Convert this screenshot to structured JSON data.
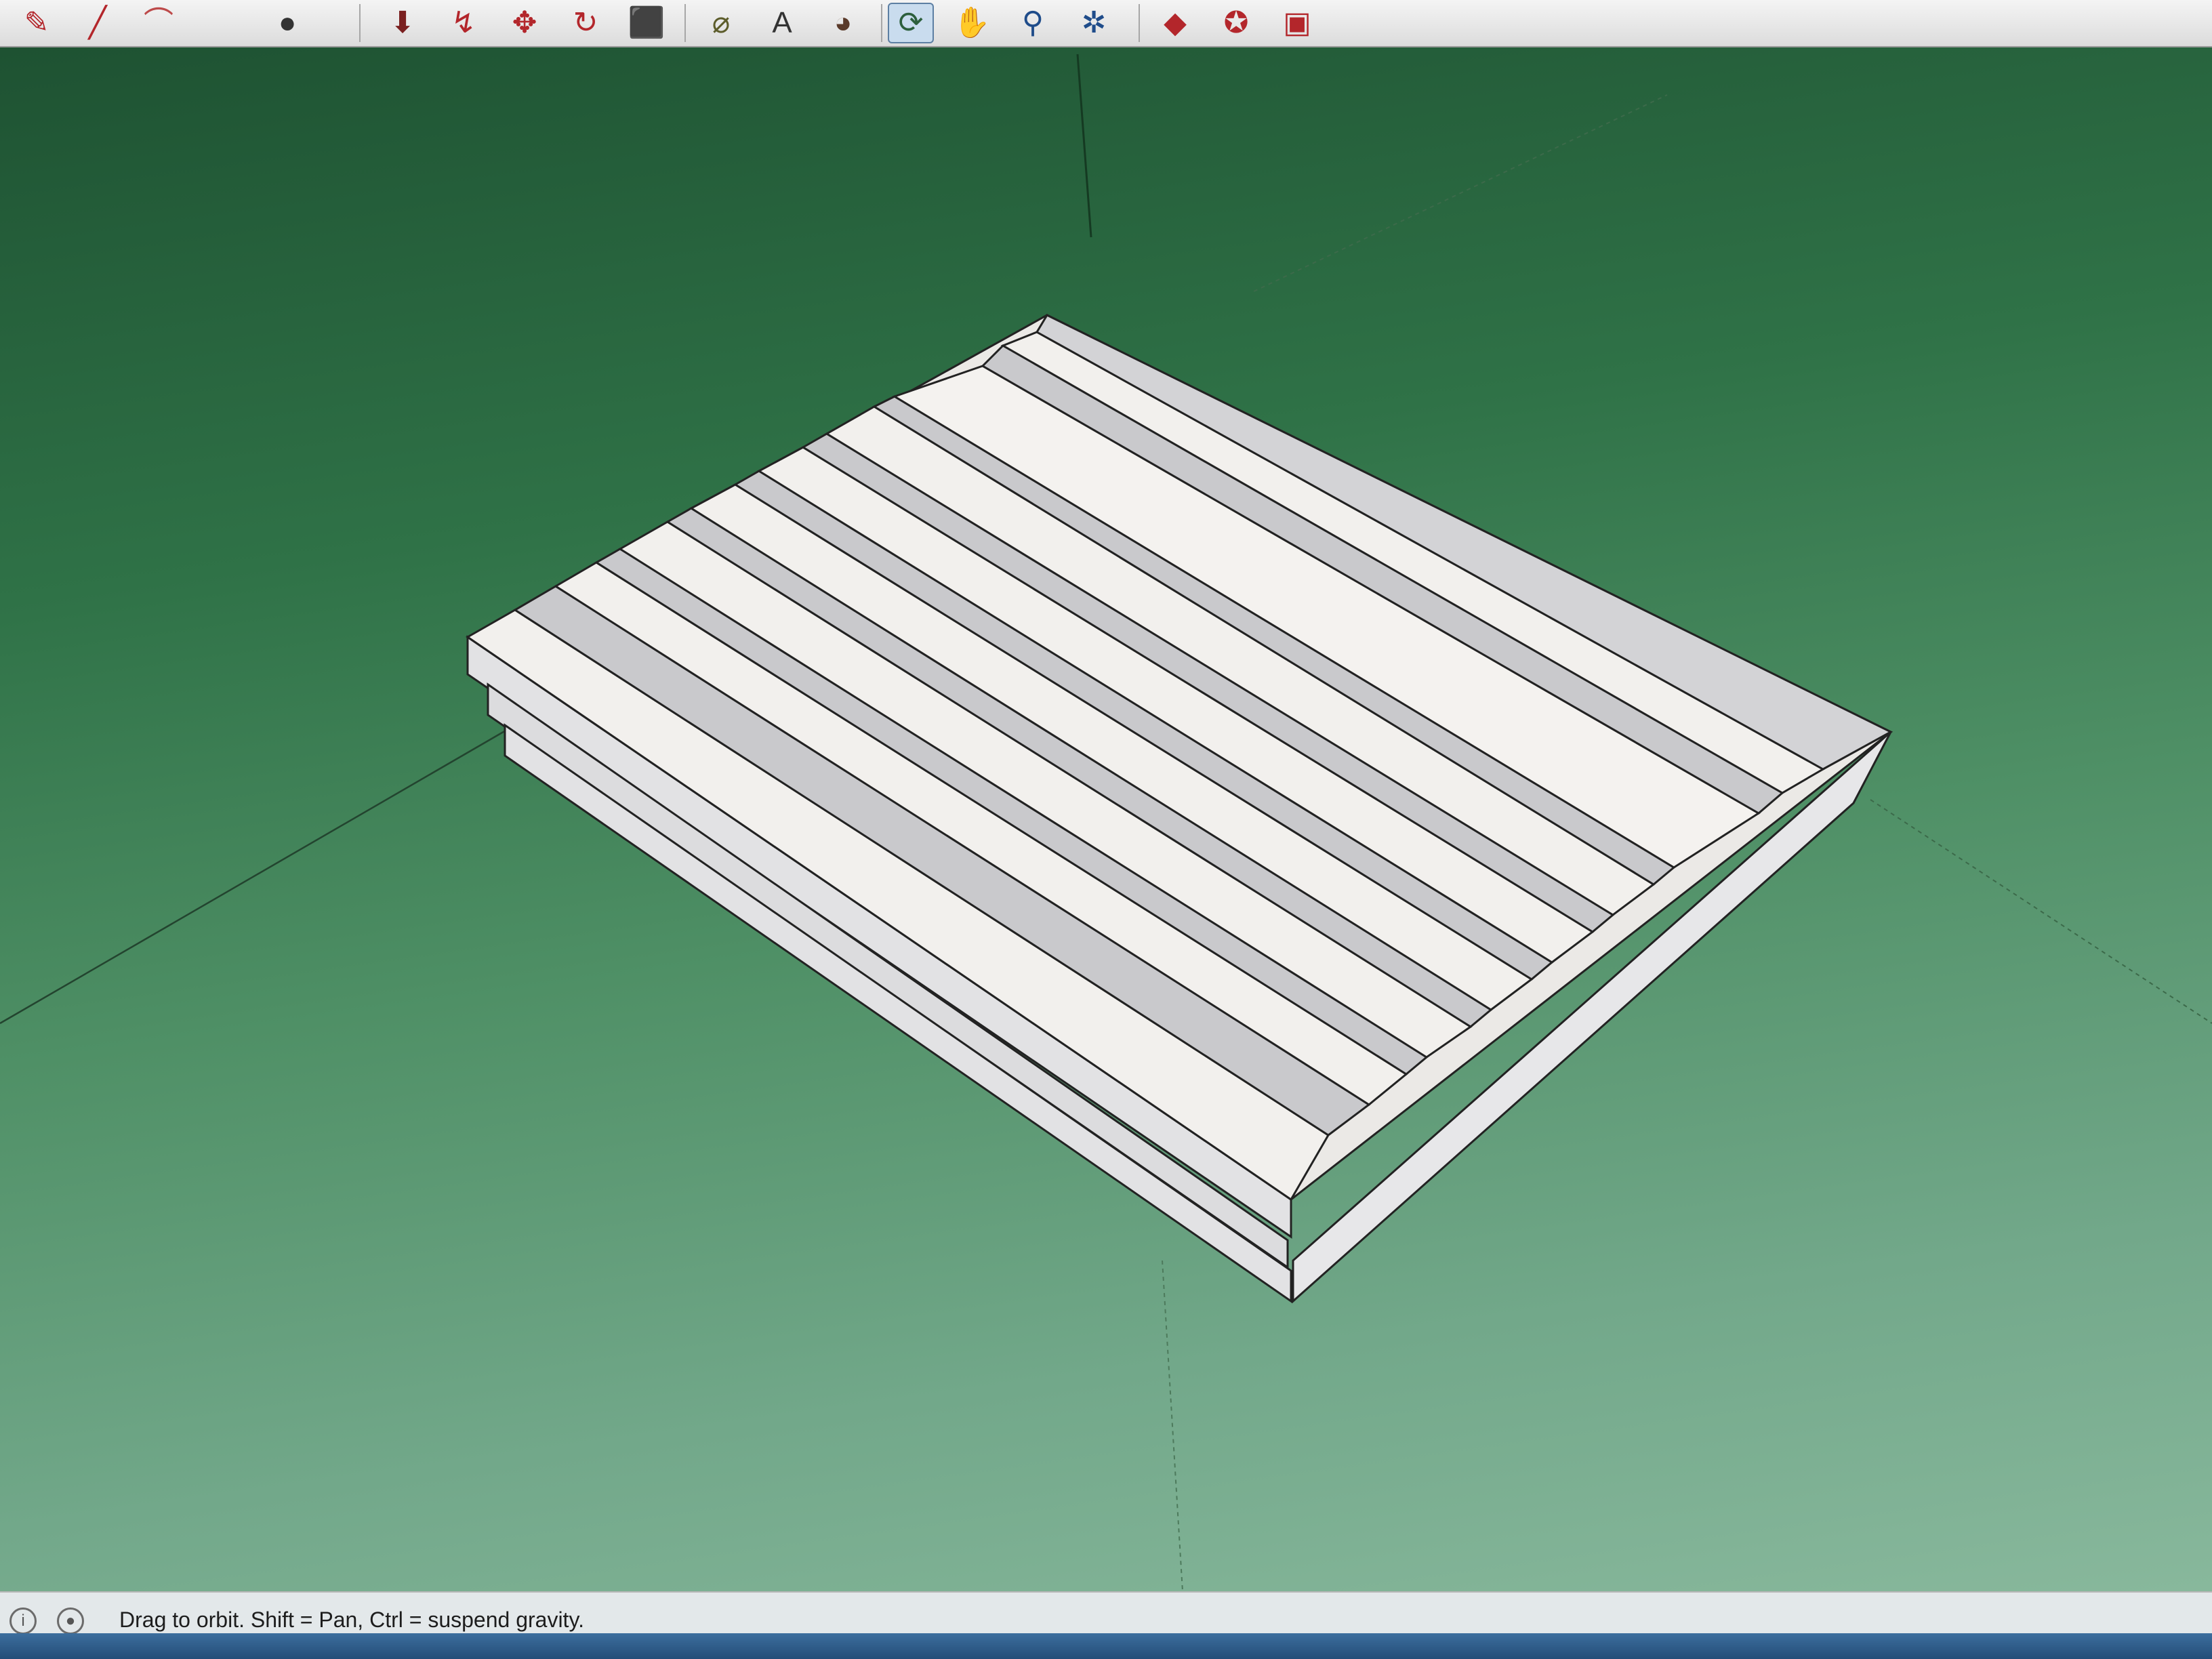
{
  "toolbar": {
    "tools": [
      {
        "icon": "eraser-icon"
      },
      {
        "icon": "pencil-line-icon"
      },
      {
        "icon": "arc-icon"
      },
      {
        "icon": "circle-shape-icon"
      },
      {
        "icon": "push-pull-icon"
      },
      {
        "icon": "follow-me-icon"
      },
      {
        "icon": "move-icon"
      },
      {
        "icon": "rotate-icon"
      },
      {
        "icon": "scale-icon"
      },
      {
        "icon": "tape-measure-icon"
      },
      {
        "icon": "text-icon"
      },
      {
        "icon": "paint-bucket-icon"
      },
      {
        "icon": "orbit-icon",
        "active": true
      },
      {
        "icon": "pan-icon"
      },
      {
        "icon": "zoom-icon"
      },
      {
        "icon": "zoom-extents-icon"
      },
      {
        "icon": "warehouse-icon"
      },
      {
        "icon": "share-model-icon"
      },
      {
        "icon": "extension-warehouse-icon"
      }
    ]
  },
  "viewport": {
    "background_color_top": "#1e5232",
    "background_color_bottom": "#88b89c",
    "model_face_color": "#f1efec",
    "model_side_color": "#e6e6e8",
    "model_edge_color": "#222222",
    "rail_count": 12
  },
  "statusbar": {
    "info_icon": "info-icon",
    "user_icon": "user-icon",
    "message": "Drag to orbit. Shift = Pan, Ctrl = suspend gravity."
  }
}
